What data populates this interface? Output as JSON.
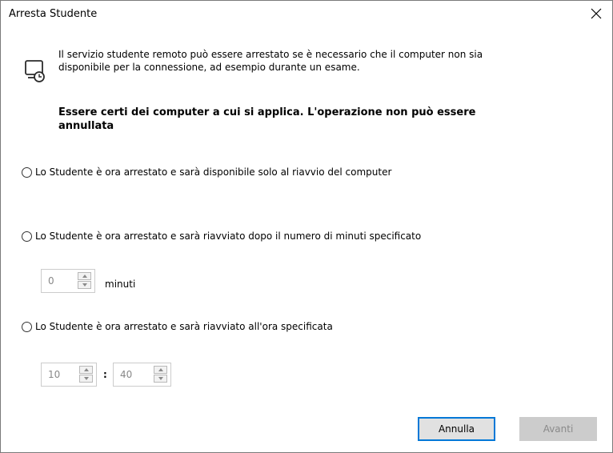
{
  "window": {
    "title": "Arresta Studente"
  },
  "info": {
    "line1": "Il servizio studente remoto può essere arrestato se è necessario che il computer non sia",
    "line2": "disponibile per la connessione, ad esempio durante un esame."
  },
  "warning": {
    "line1": "Essere certi dei computer a cui si applica. L'operazione non può essere",
    "line2": "annullata"
  },
  "options": [
    {
      "label": "Lo Studente è ora arrestato e sarà disponibile solo al riavvio del computer",
      "selected": false
    },
    {
      "label": "Lo Studente è ora arrestato e sarà riavviato dopo il numero di minuti specificato",
      "selected": false
    },
    {
      "label": "Lo Studente è ora arrestato e sarà riavviato all'ora specificata",
      "selected": false
    }
  ],
  "minutes": {
    "value": "0",
    "unit_label": "minuti"
  },
  "time": {
    "hours": "10",
    "separator": ":",
    "minutes": "40"
  },
  "buttons": {
    "cancel": "Annulla",
    "next": "Avanti"
  },
  "colors": {
    "accent": "#0078d7",
    "disabled_bg": "#cccccc",
    "disabled_text": "#8a8a8a"
  }
}
